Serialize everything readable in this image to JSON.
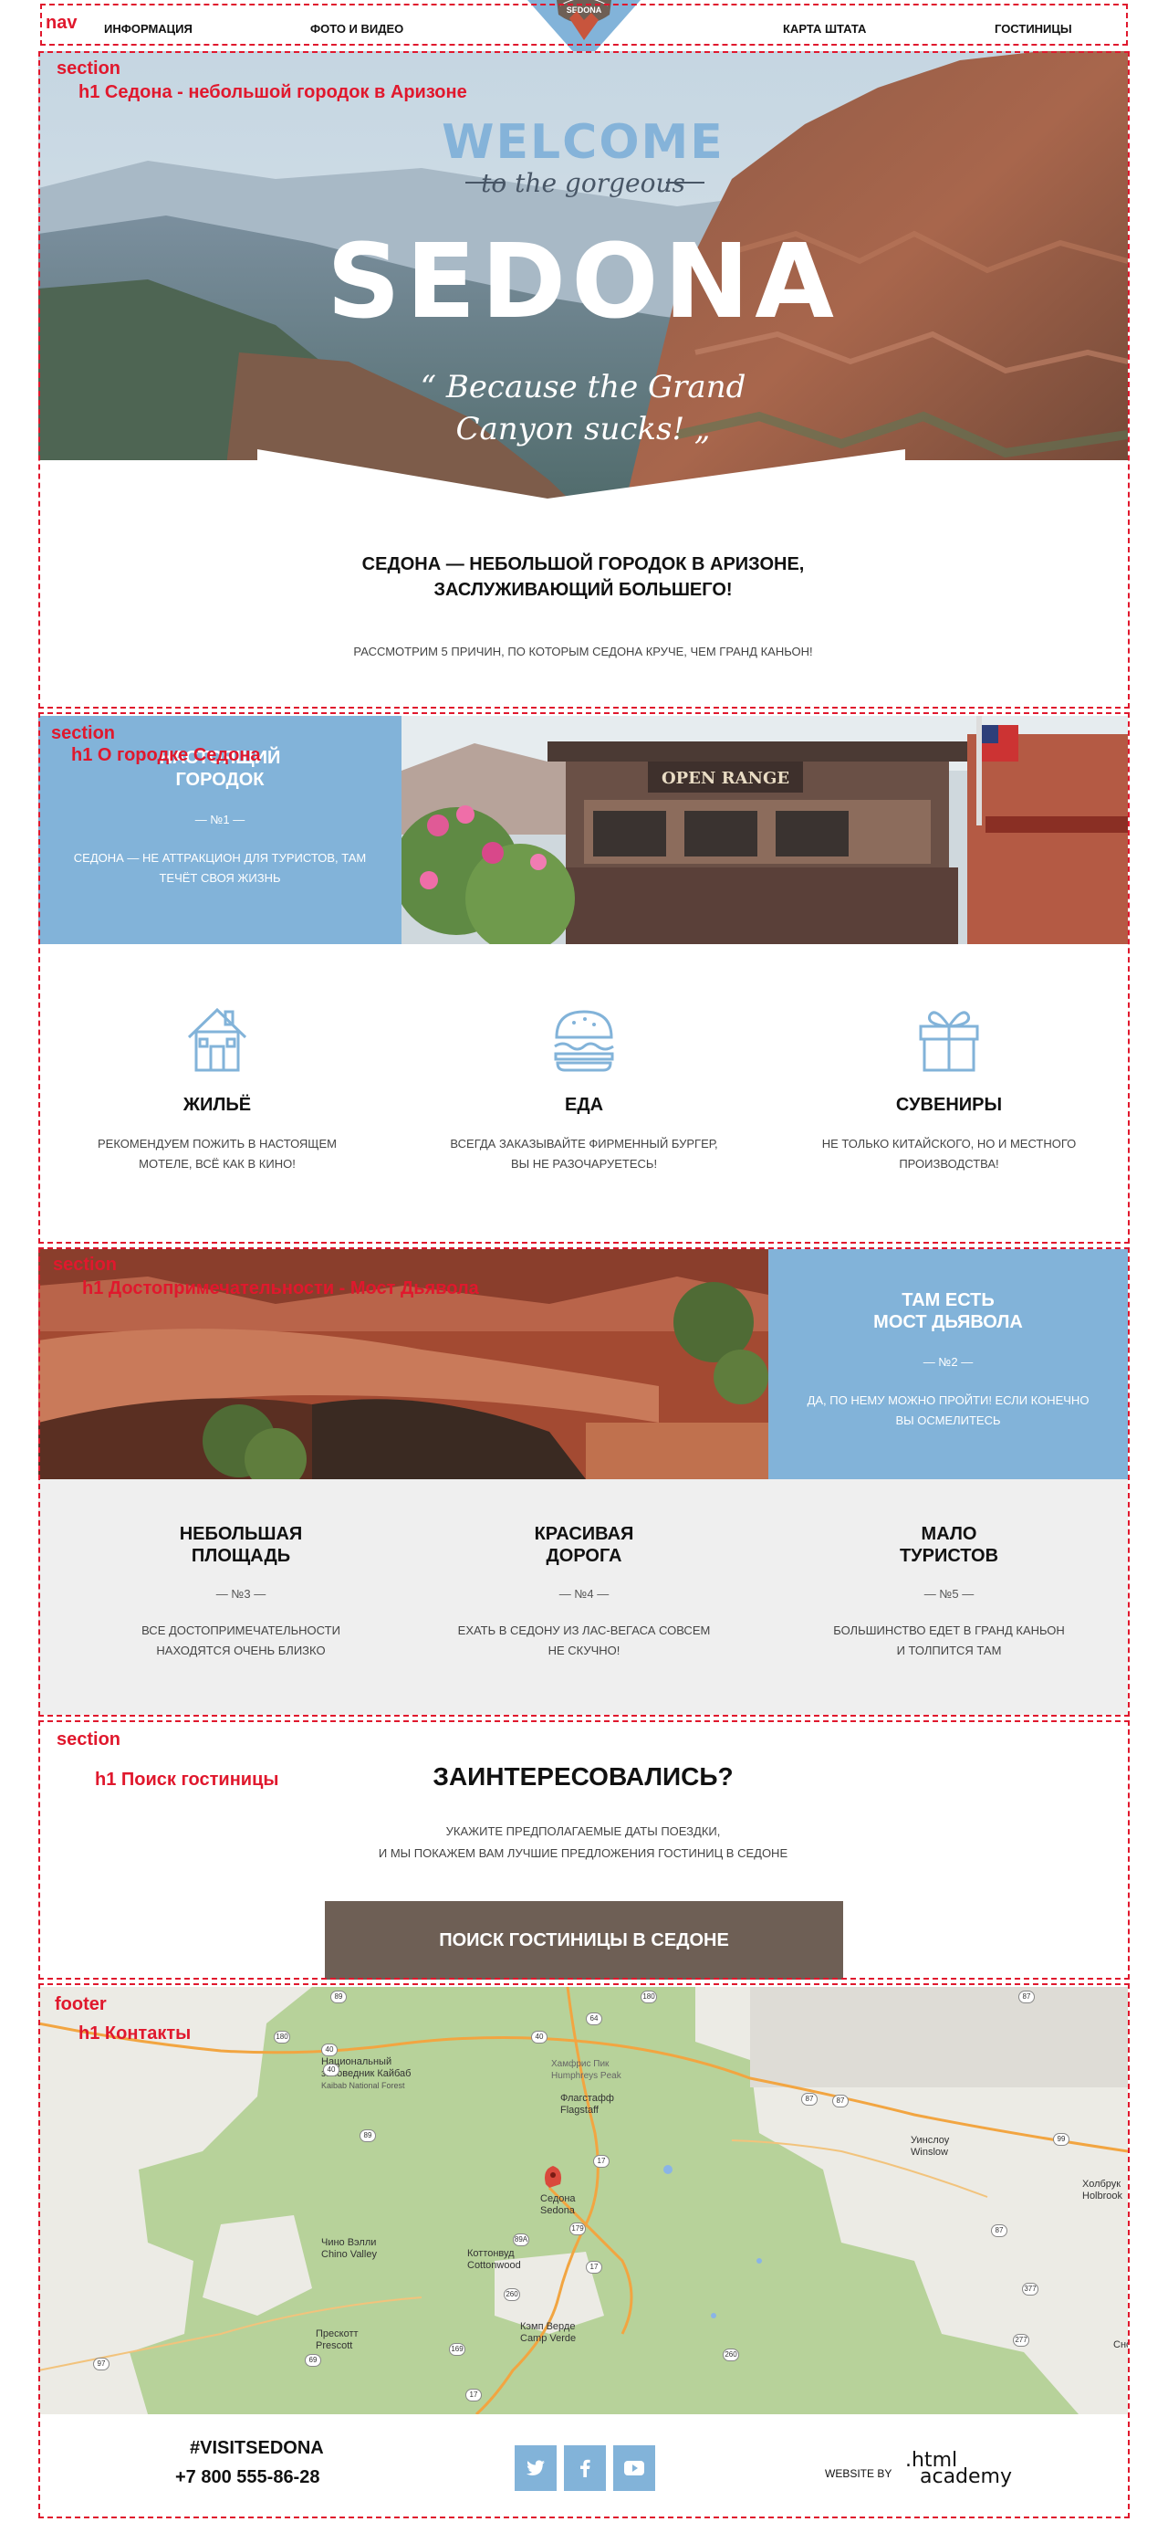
{
  "debug": {
    "nav": "nav",
    "section": "section",
    "footer": "footer",
    "h1_hero": "h1 Седона - небольшой городок в Аризоне",
    "h1_about": "h1 О городке Седона",
    "h1_sights": "h1 Достопримечательности - Мост Дьявола",
    "h1_search": "h1 Поиск гостиницы",
    "h1_contacts": "h1 Контакты"
  },
  "nav": {
    "links": [
      "ИНФОРМАЦИЯ",
      "ФОТО И ВИДЕО",
      "КАРТА ШТАТА",
      "ГОСТИНИЦЫ"
    ],
    "logo_text": "SEDONA"
  },
  "hero": {
    "welcome": "WELCOME",
    "gorgeous": "to the gorgeous",
    "sedona": "SEDONA",
    "quote_line1": "“ Because the Grand",
    "quote_line2": "Canyon sucks! „"
  },
  "intro": {
    "title_line1": "СЕДОНА — НЕБОЛЬШОЙ ГОРОДОК В АРИЗОНЕ,",
    "title_line2": "ЗАСЛУЖИВАЮЩИЙ БОЛЬШЕГО!",
    "subtitle": "РАССМОТРИМ 5 ПРИЧИН, ПО КОТОРЫМ СЕДОНА КРУЧЕ, ЧЕМ ГРАНД КАНЬОН!"
  },
  "reason1": {
    "title_line1": "НАСТОЯЩИЙ",
    "title_line2": "ГОРОДОК",
    "num": "— №1 —",
    "text_line1": "СЕДОНА — НЕ АТТРАКЦИОН ДЛЯ ТУРИСТОВ, ТАМ",
    "text_line2": "ТЕЧЁТ СВОЯ ЖИЗНЬ",
    "sign_text": "OPEN RANGE"
  },
  "features": [
    {
      "icon": "house-icon",
      "title": "ЖИЛЬЁ",
      "line1": "РЕКОМЕНДУЕМ ПОЖИТЬ В НАСТОЯЩЕМ",
      "line2": "МОТЕЛЕ, ВСЁ КАК В КИНО!"
    },
    {
      "icon": "burger-icon",
      "title": "ЕДА",
      "line1": "ВСЕГДА ЗАКАЗЫВАЙТЕ ФИРМЕННЫЙ БУРГЕР,",
      "line2": "ВЫ НЕ РАЗОЧАРУЕТЕСЬ!"
    },
    {
      "icon": "gift-icon",
      "title": "СУВЕНИРЫ",
      "line1": "НЕ ТОЛЬКО КИТАЙСКОГО, НО И МЕСТНОГО",
      "line2": "ПРОИЗВОДСТВА!"
    }
  ],
  "reason2": {
    "title_line1": "ТАМ ЕСТЬ",
    "title_line2": "МОСТ ДЬЯВОЛА",
    "num": "— №2 —",
    "text_line1": "ДА, ПО НЕМУ МОЖНО ПРОЙТИ! ЕСЛИ КОНЕЧНО",
    "text_line2": "ВЫ ОСМЕЛИТЕСЬ"
  },
  "reasons": [
    {
      "title_line1": "НЕБОЛЬШАЯ",
      "title_line2": "ПЛОЩАДЬ",
      "num": "— №3 —",
      "line1": "ВСЕ ДОСТОПРИМЕЧАТЕЛЬНОСТИ",
      "line2": "НАХОДЯТСЯ ОЧЕНЬ БЛИЗКО"
    },
    {
      "title_line1": "КРАСИВАЯ",
      "title_line2": "ДОРОГА",
      "num": "— №4 —",
      "line1": "ЕХАТЬ В СЕДОНУ ИЗ ЛАС-ВЕГАСА СОВСЕМ",
      "line2": "НЕ СКУЧНО!"
    },
    {
      "title_line1": "МАЛО",
      "title_line2": "ТУРИСТОВ",
      "num": "— №5 —",
      "line1": "БОЛЬШИНСТВО ЕДЕТ В ГРАНД КАНЬОН",
      "line2": "И ТОЛПИТСЯ ТАМ"
    }
  ],
  "interest": {
    "title": "ЗАИНТЕРЕСОВАЛИСЬ?",
    "line1": "УКАЖИТЕ ПРЕДПОЛАГАЕМЫЕ ДАТЫ ПОЕЗДКИ,",
    "line2": "И МЫ ПОКАЖЕМ ВАМ ЛУЧШИЕ ПРЕДЛОЖЕНИЯ ГОСТИНИЦ В СЕДОНЕ",
    "button": "ПОИСК ГОСТИНИЦЫ В СЕДОНЕ"
  },
  "map": {
    "labels": {
      "flagstaff_ru": "Флагстафф",
      "flagstaff": "Flagstaff",
      "humphreys_ru": "Хамфрис Пик",
      "humphreys": "Humphreys Peak",
      "kaibab_ru": "Национальный",
      "kaibab_ru2": "заповедник Кайбаб",
      "kaibab": "Kaibab National Forest",
      "sedona_ru": "Седона",
      "sedona": "Sedona",
      "chino_ru": "Чино Вэлли",
      "chino": "Chino Valley",
      "cottonwood_ru": "Коттонвуд",
      "cottonwood": "Cottonwood",
      "prescott_ru": "Прескотт",
      "prescott": "Prescott",
      "campverde_ru": "Кэмп Верде",
      "campverde": "Camp Verde",
      "winslow_ru": "Уинслоу",
      "winslow": "Winslow",
      "holbrook_ru": "Холбрук",
      "holbrook": "Holbrook",
      "edge_ru": "Сно"
    },
    "shields": [
      "180",
      "89",
      "64",
      "40",
      "40",
      "17",
      "89A",
      "179",
      "260",
      "17",
      "169",
      "87",
      "99",
      "87",
      "87",
      "377",
      "277",
      "69",
      "97",
      "89",
      "40",
      "180",
      "260",
      "17",
      "87"
    ]
  },
  "footer": {
    "hashtag": "#VISITSEDONA",
    "phone": "+7 800 555-86-28",
    "website_by": "WEBSITE BY",
    "academy_top": ".html",
    "academy_bottom": "academy"
  }
}
